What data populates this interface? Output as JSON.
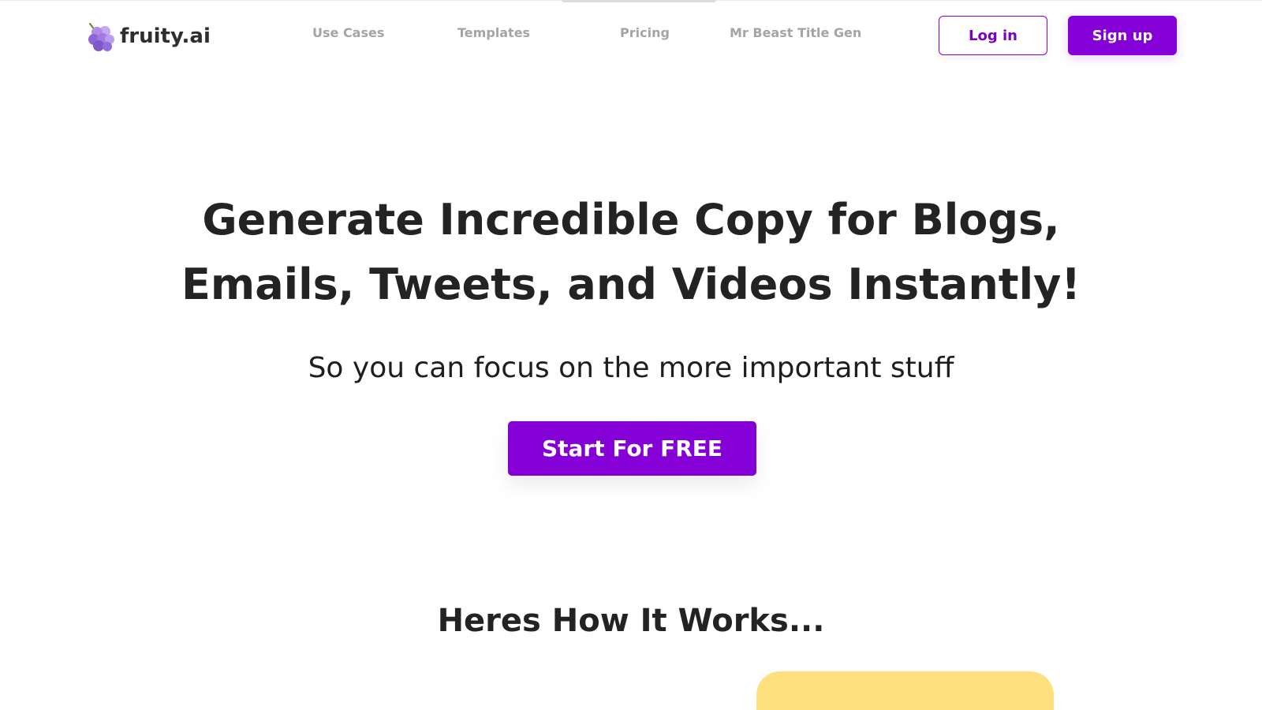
{
  "brand": {
    "name": "fruity.ai",
    "logo_icon": "grapes-icon"
  },
  "nav": {
    "links": [
      {
        "label": "Use Cases"
      },
      {
        "label": "Templates"
      },
      {
        "label": "Pricing"
      },
      {
        "label": "Mr Beast Title Gen"
      }
    ]
  },
  "auth": {
    "login_label": "Log in",
    "signup_label": "Sign up"
  },
  "hero": {
    "title_line_1": "Generate Incredible Copy for Blogs,",
    "title_line_2": "Emails, Tweets, and Videos Instantly!",
    "subtitle": "So you can focus on the more important stuff",
    "cta_label": "Start For FREE"
  },
  "how_it_works": {
    "title": "Heres How It Works..."
  },
  "colors": {
    "accent": "#8400d6",
    "heading": "#232323",
    "nav_text": "#a4a4a4",
    "card_yellow": "#ffe07f"
  }
}
